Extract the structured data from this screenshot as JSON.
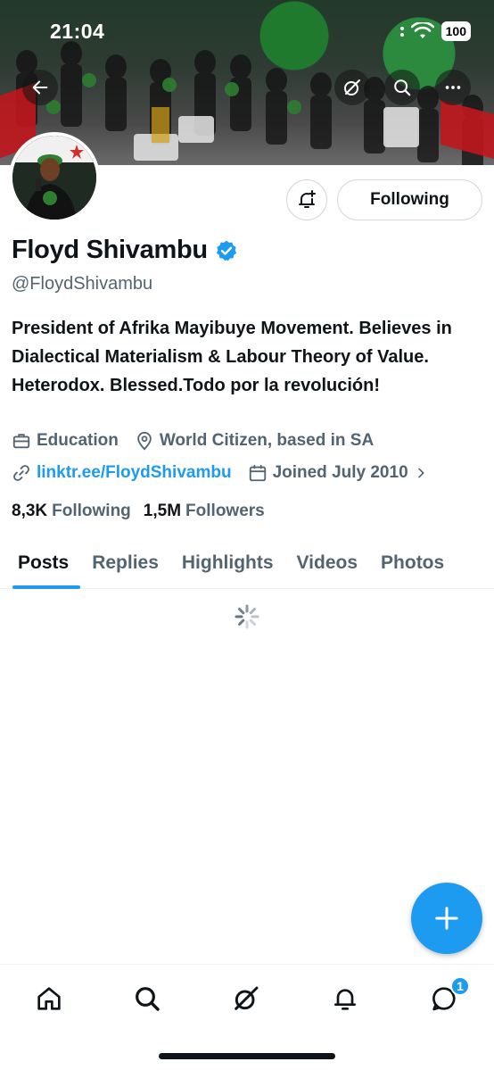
{
  "status_bar": {
    "time": "21:04",
    "battery": "100"
  },
  "profile": {
    "name": "Floyd Shivambu",
    "handle": "@FloydShivambu",
    "bio": "President of Afrika Mayibuye Movement. Believes in Dialectical Materialism & Labour Theory of Value. Heterodox. Blessed.Todo por la revolución!",
    "category": "Education",
    "location": "World Citizen, based in SA",
    "link": "linktr.ee/FloydShivambu",
    "joined": "Joined July 2010",
    "following_count": "8,3K",
    "following_label": "Following",
    "followers_count": "1,5M",
    "followers_label": "Followers",
    "verified": true
  },
  "actions": {
    "follow_button": "Following"
  },
  "tabs": [
    {
      "label": "Posts",
      "active": true
    },
    {
      "label": "Replies",
      "active": false
    },
    {
      "label": "Highlights",
      "active": false
    },
    {
      "label": "Videos",
      "active": false
    },
    {
      "label": "Photos",
      "active": false
    }
  ],
  "bottom_nav": {
    "items": [
      "home-icon",
      "search-icon",
      "grok-icon",
      "notifications-icon",
      "messages-icon"
    ],
    "messages_badge": "1"
  },
  "colors": {
    "accent": "#1d9bf0",
    "text": "#0f1419",
    "secondary": "#536471"
  }
}
